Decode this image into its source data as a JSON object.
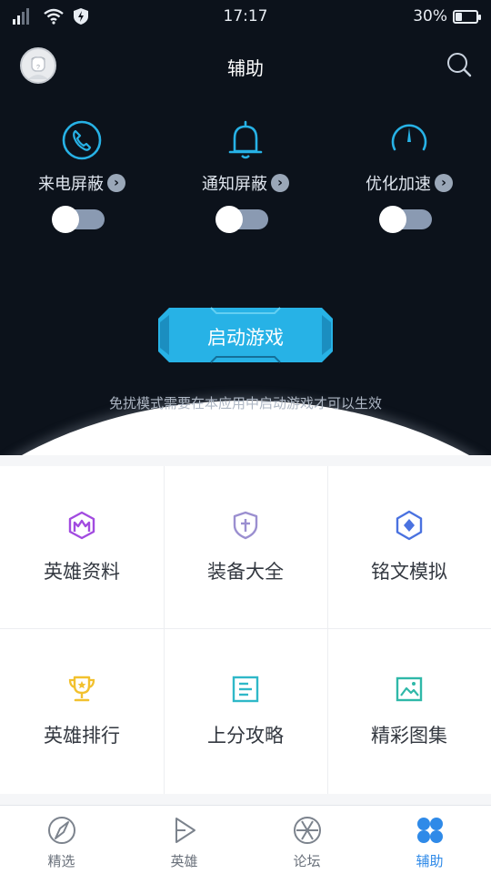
{
  "status_bar": {
    "time": "17:17",
    "battery_text": "30%",
    "battery_level": 0.3
  },
  "header": {
    "title": "辅助",
    "avatar_icon": "user-avatar-placeholder",
    "search_icon": "search-icon"
  },
  "features": [
    {
      "label": "来电屏蔽",
      "icon": "phone-icon",
      "enabled": false
    },
    {
      "label": "通知屏蔽",
      "icon": "bell-icon",
      "enabled": false
    },
    {
      "label": "优化加速",
      "icon": "speedometer-icon",
      "enabled": false
    }
  ],
  "start_button": {
    "label": "启动游戏"
  },
  "notice": "免扰模式需要在本应用中启动游戏才可以生效",
  "grid": [
    {
      "label": "英雄资料",
      "icon": "hero-helmet-icon",
      "color": "#a24be0"
    },
    {
      "label": "装备大全",
      "icon": "shield-cross-icon",
      "color": "#9b8fd0"
    },
    {
      "label": "铭文模拟",
      "icon": "hexagon-gem-icon",
      "color": "#4a72e0"
    },
    {
      "label": "英雄排行",
      "icon": "trophy-icon",
      "color": "#f2c12e"
    },
    {
      "label": "上分攻略",
      "icon": "document-icon",
      "color": "#2fb8c8"
    },
    {
      "label": "精彩图集",
      "icon": "image-gallery-icon",
      "color": "#2fb8a8"
    }
  ],
  "tabs": [
    {
      "label": "精选",
      "icon": "compass-icon",
      "active": false
    },
    {
      "label": "英雄",
      "icon": "play-triangle-icon",
      "active": false
    },
    {
      "label": "论坛",
      "icon": "aperture-icon",
      "active": false
    },
    {
      "label": "辅助",
      "icon": "four-petals-icon",
      "active": true
    }
  ],
  "colors": {
    "dark_bg": "#0c121b",
    "accent_cyan": "#27b2e6",
    "active_tab": "#2f8ae8"
  }
}
